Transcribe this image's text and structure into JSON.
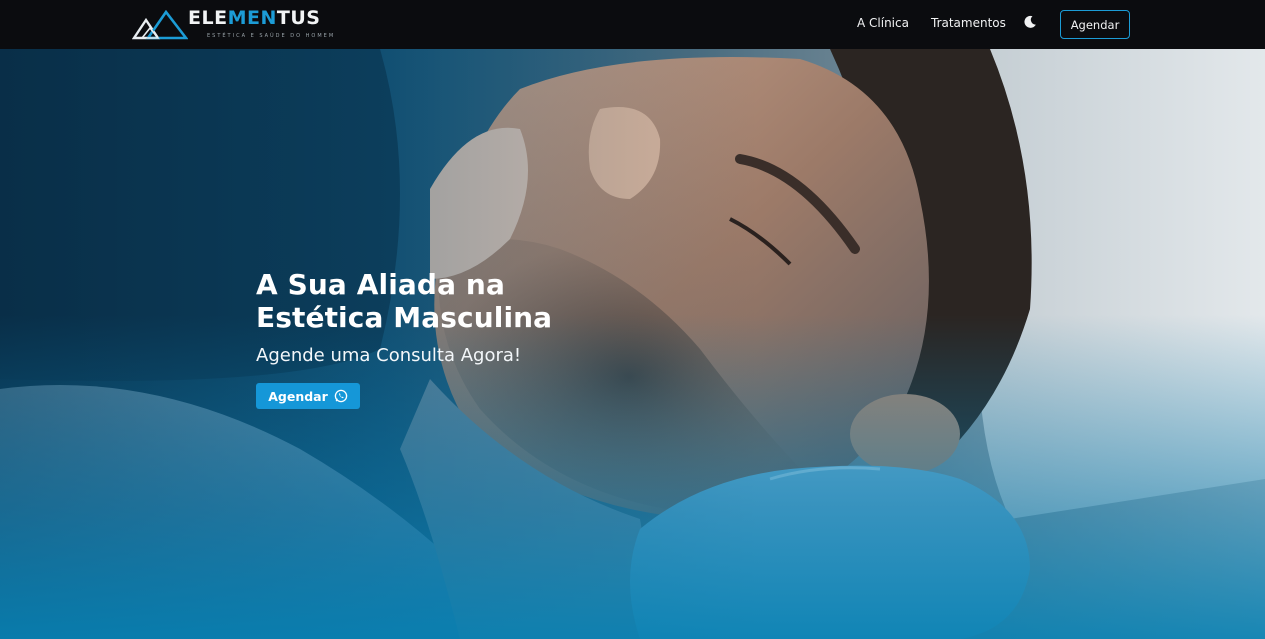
{
  "header": {
    "logo": {
      "name_part1": "ELE",
      "name_accent": "MEN",
      "name_part2": "TUS",
      "tagline": "ESTÉTICA E SAÚDE DO HOMEM"
    },
    "nav": {
      "clinica": "A Clínica",
      "tratamentos": "Tratamentos",
      "cta": "Agendar"
    },
    "theme_toggle_icon": "moon-icon"
  },
  "hero": {
    "title_line1": "A Sua Aliada na",
    "title_line2": "Estética Masculina",
    "subtitle": "Agende uma Consulta Agora!",
    "cta": "Agendar",
    "cta_icon": "whatsapp-icon"
  },
  "colors": {
    "accent": "#1c9cd6",
    "header_bg": "#0b0c0f",
    "cta_bg": "#1597d8"
  }
}
